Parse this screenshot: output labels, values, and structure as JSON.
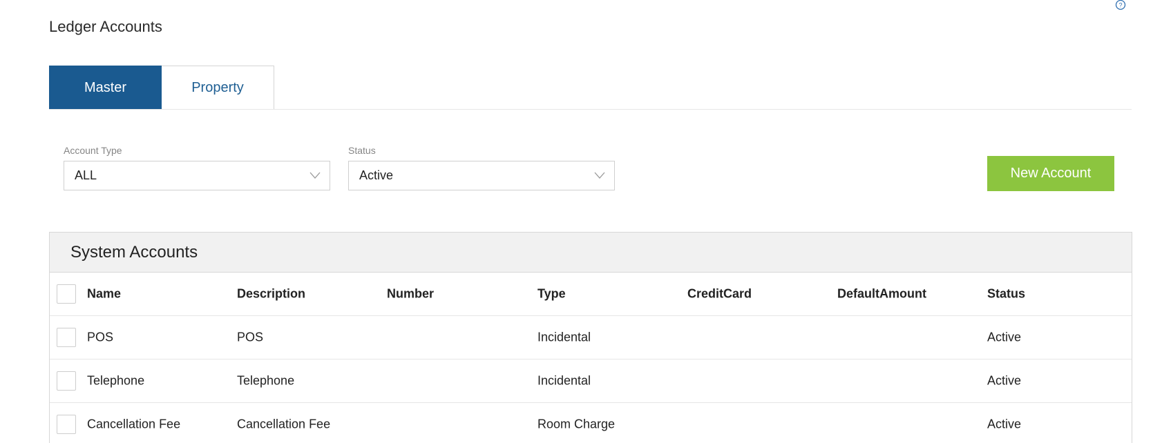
{
  "page": {
    "title": "Ledger Accounts"
  },
  "tabs": [
    {
      "label": "Master",
      "active": true
    },
    {
      "label": "Property",
      "active": false
    }
  ],
  "filters": {
    "account_type": {
      "label": "Account Type",
      "value": "ALL"
    },
    "status": {
      "label": "Status",
      "value": "Active"
    }
  },
  "actions": {
    "new_account_label": "New Account"
  },
  "panel": {
    "title": "System Accounts",
    "columns": [
      "Name",
      "Description",
      "Number",
      "Type",
      "CreditCard",
      "DefaultAmount",
      "Status"
    ],
    "rows": [
      {
        "name": "POS",
        "description": "POS",
        "number": "",
        "type": "Incidental",
        "creditcard": "",
        "defaultamount": "",
        "status": "Active"
      },
      {
        "name": "Telephone",
        "description": "Telephone",
        "number": "",
        "type": "Incidental",
        "creditcard": "",
        "defaultamount": "",
        "status": "Active"
      },
      {
        "name": "Cancellation Fee",
        "description": "Cancellation Fee",
        "number": "",
        "type": "Room Charge",
        "creditcard": "",
        "defaultamount": "",
        "status": "Active"
      }
    ]
  },
  "colors": {
    "tab_active": "#1a5a90",
    "tab_inactive_text": "#1f5f93",
    "new_button": "#8cc53f",
    "panel_header_bg": "#f1f1f1"
  },
  "icons": {
    "help": "help-circle-icon",
    "select_arrow": "chevron-down-icon"
  }
}
